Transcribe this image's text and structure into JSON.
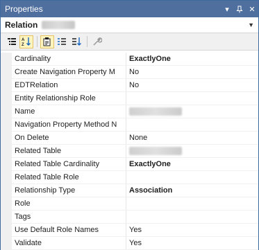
{
  "window": {
    "title": "Properties"
  },
  "object_bar": {
    "label": "Relation"
  },
  "toolbar": {
    "buttons": [
      "categorized-icon",
      "alphabetical-icon",
      "properties-icon",
      "events-icon",
      "sort-icon",
      "wrench-icon"
    ]
  },
  "rows": [
    {
      "name": "Cardinality",
      "value": "ExactlyOne",
      "bold": true
    },
    {
      "name": "Create Navigation Property M",
      "value": "No",
      "bold": false
    },
    {
      "name": "EDTRelation",
      "value": "No",
      "bold": false
    },
    {
      "name": "Entity Relationship Role",
      "value": "",
      "bold": false
    },
    {
      "name": "Name",
      "value": "",
      "bold": false,
      "blurred": true
    },
    {
      "name": "Navigation Property Method N",
      "value": "",
      "bold": false
    },
    {
      "name": "On Delete",
      "value": "None",
      "bold": false
    },
    {
      "name": "Related Table",
      "value": "",
      "bold": false,
      "blurred": true
    },
    {
      "name": "Related Table Cardinality",
      "value": "ExactlyOne",
      "bold": true
    },
    {
      "name": "Related Table Role",
      "value": "",
      "bold": false
    },
    {
      "name": "Relationship Type",
      "value": "Association",
      "bold": true
    },
    {
      "name": "Role",
      "value": "",
      "bold": false
    },
    {
      "name": "Tags",
      "value": "",
      "bold": false
    },
    {
      "name": "Use Default Role Names",
      "value": "Yes",
      "bold": false
    },
    {
      "name": "Validate",
      "value": "Yes",
      "bold": false
    }
  ]
}
